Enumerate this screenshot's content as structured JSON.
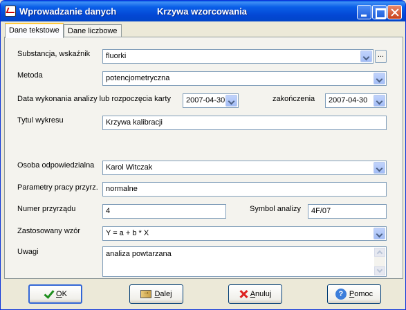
{
  "window": {
    "title_left": "Wprowadzanie danych",
    "title_center": "Krzywa wzorcowania"
  },
  "tabs": [
    {
      "label": "Dane tekstowe",
      "active": true
    },
    {
      "label": "Dane liczbowe",
      "active": false
    }
  ],
  "form": {
    "substancja": {
      "label": "Substancja, wskaźnik",
      "value": "fluorki",
      "ellipsis": "..."
    },
    "metoda": {
      "label": "Metoda",
      "value": "potencjometryczna"
    },
    "data_start": {
      "label": "Data wykonania analizy lub rozpoczęcia karty",
      "value": "2007-04-30"
    },
    "data_end": {
      "label": "zakończenia",
      "value": "2007-04-30"
    },
    "tytul": {
      "label": "Tytul wykresu",
      "value": "Krzywa kalibracji"
    },
    "osoba": {
      "label": "Osoba odpowiedzialna",
      "value": "Karol Witczak"
    },
    "parametry": {
      "label": "Parametry pracy przyrz.",
      "value": "normalne"
    },
    "numer": {
      "label": "Numer przyrządu",
      "value": "4"
    },
    "symbol": {
      "label": "Symbol analizy",
      "value": "4F/07"
    },
    "wzor": {
      "label": "Zastosowany wzór",
      "value": "Y = a + b * X"
    },
    "uwagi": {
      "label": "Uwagi",
      "value": "analiza powtarzana"
    }
  },
  "buttons": {
    "ok": "OK",
    "dalej": "Dalej",
    "anuluj": "Anuluj",
    "pomoc": "Pomoc"
  },
  "icons": {
    "ok": "check-icon",
    "dalej": "door-exit-icon",
    "anuluj": "x-icon",
    "pomoc": "help-icon"
  },
  "colors": {
    "titlebar": "#0A5FE8",
    "window_bg": "#ECE9D8",
    "panel_bg": "#F4F3EE",
    "field_border": "#7F9DB9"
  }
}
